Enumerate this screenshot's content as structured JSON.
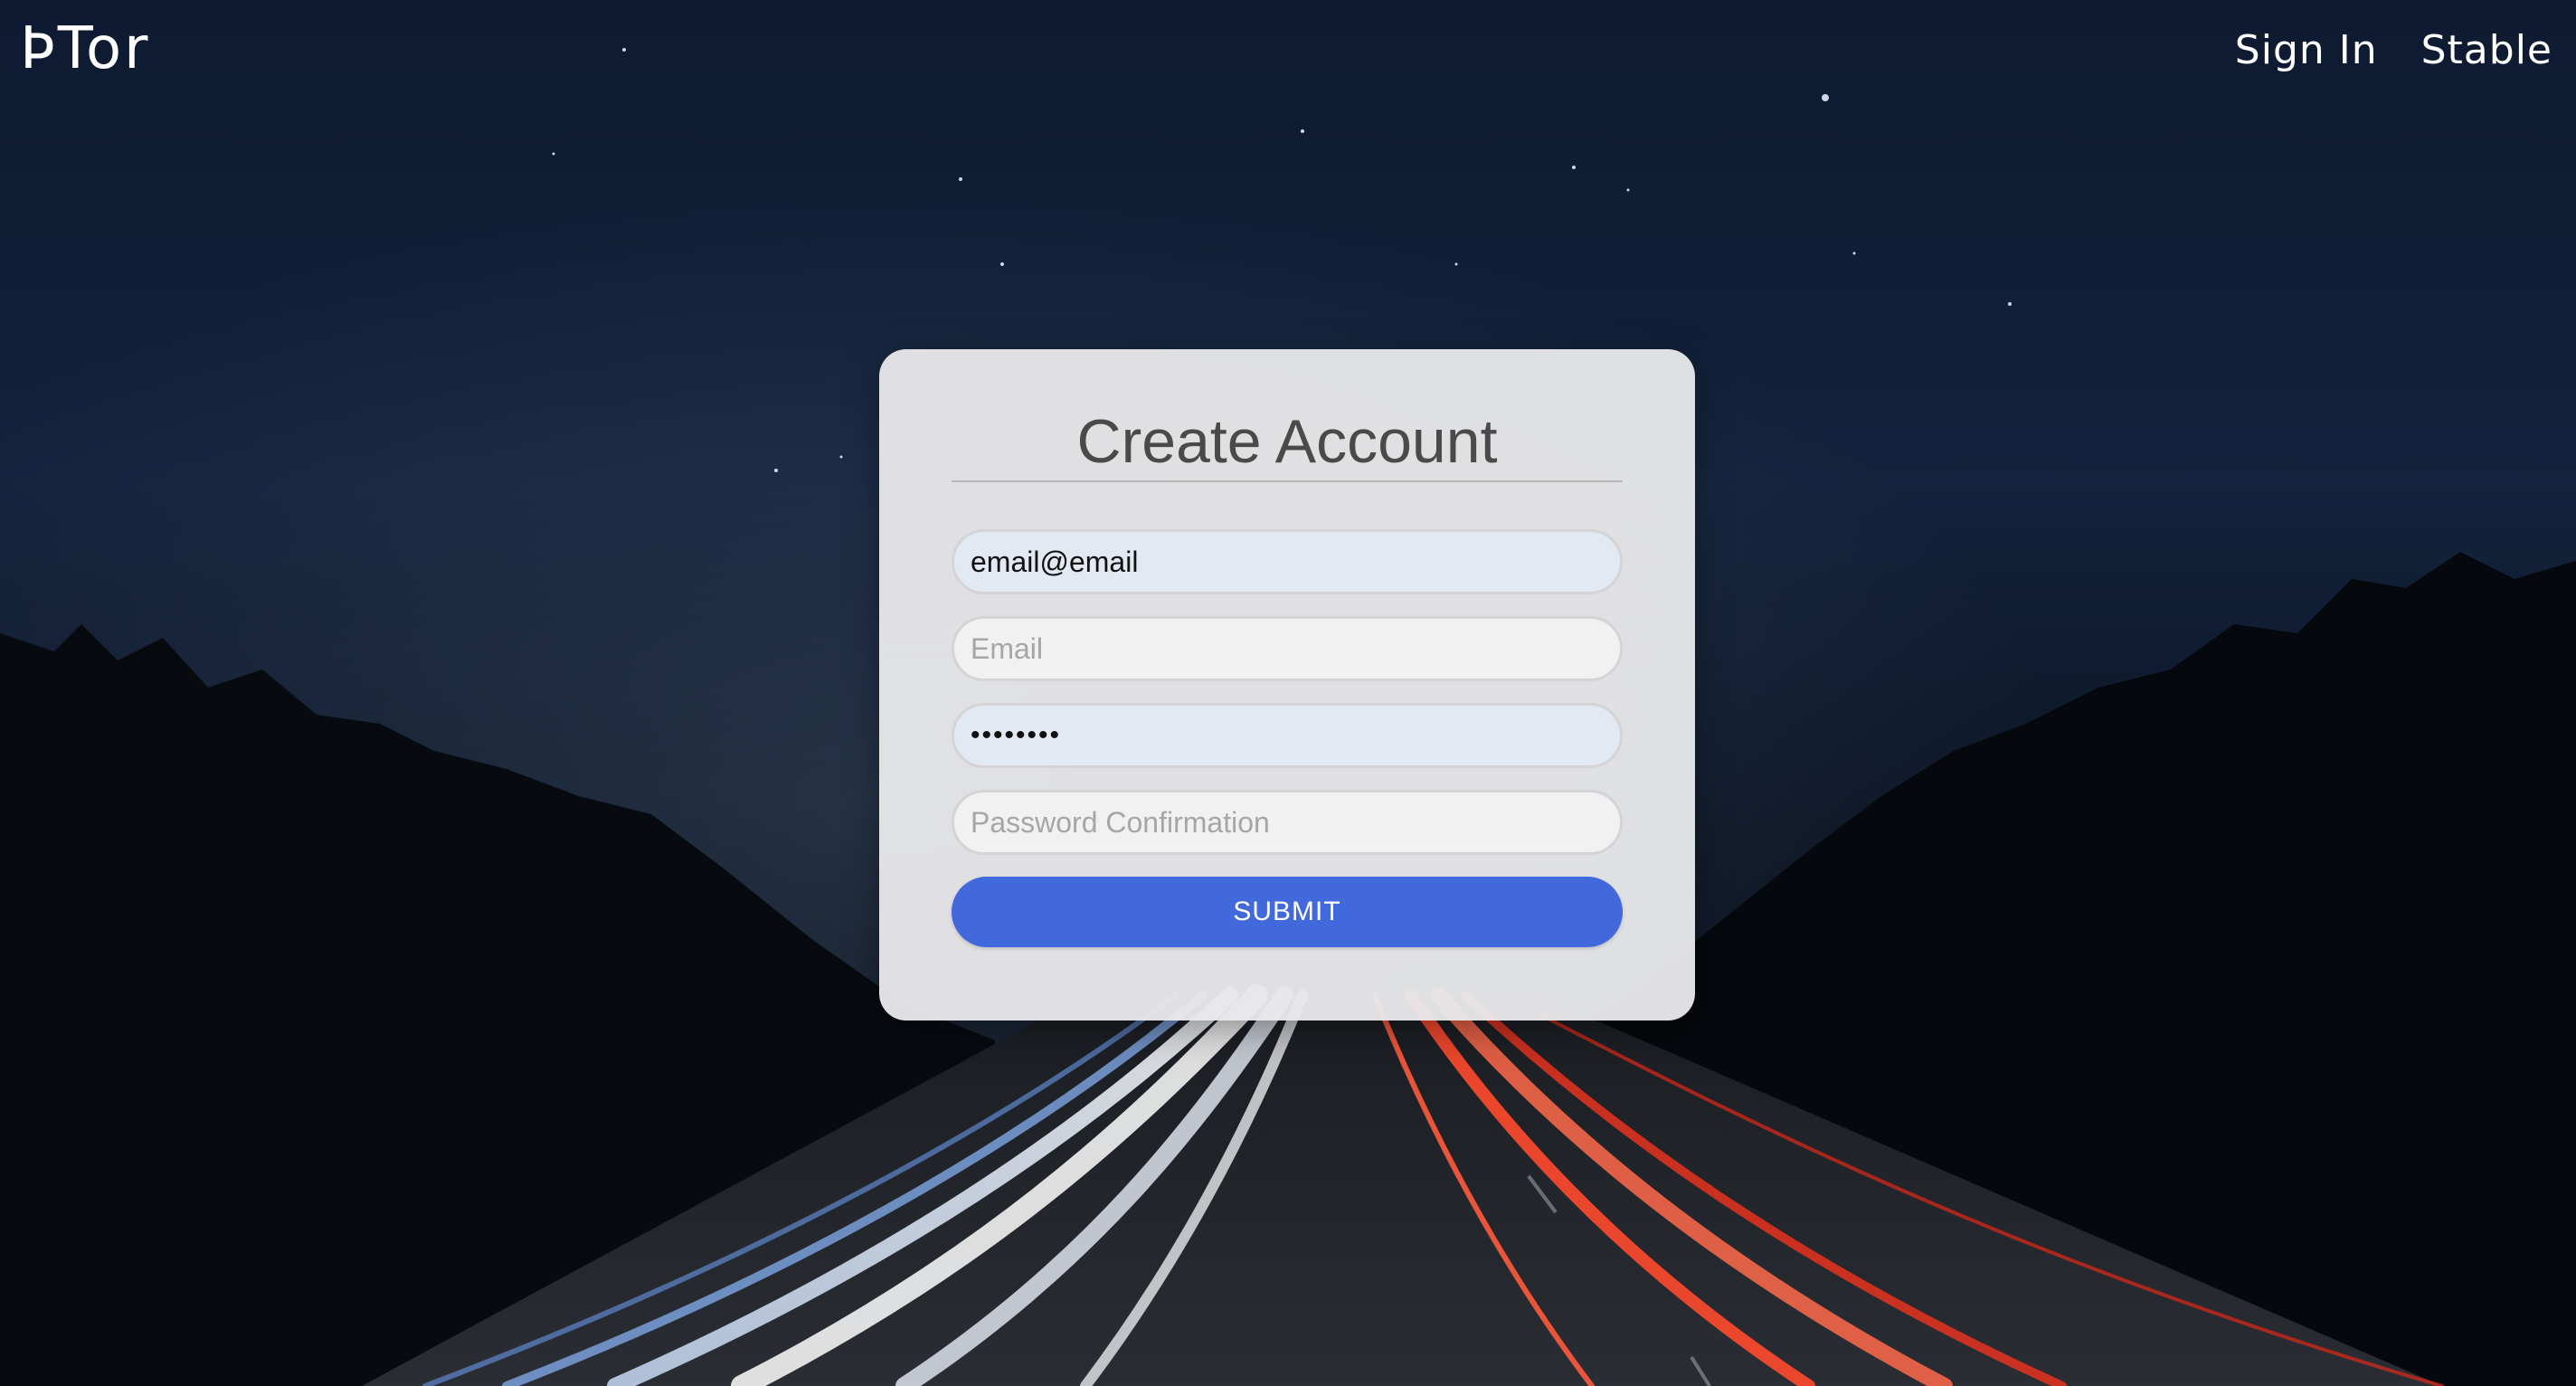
{
  "nav": {
    "logo_text": "ÞTor",
    "links": [
      {
        "label": "Sign In"
      },
      {
        "label": "Stable"
      }
    ]
  },
  "form": {
    "title": "Create Account",
    "fields": {
      "username": {
        "value": "email@email",
        "placeholder": ""
      },
      "email": {
        "value": "",
        "placeholder": "Email"
      },
      "password": {
        "value": "••••••••",
        "placeholder": ""
      },
      "password_confirmation": {
        "value": "",
        "placeholder": "Password Confirmation"
      }
    },
    "submit_label": "SUBMIT"
  },
  "colors": {
    "submit_button": "#4169dc",
    "autofill_field": "#e3e9f3",
    "card_background": "#e8e8ea",
    "sky": "#0f1e36"
  }
}
